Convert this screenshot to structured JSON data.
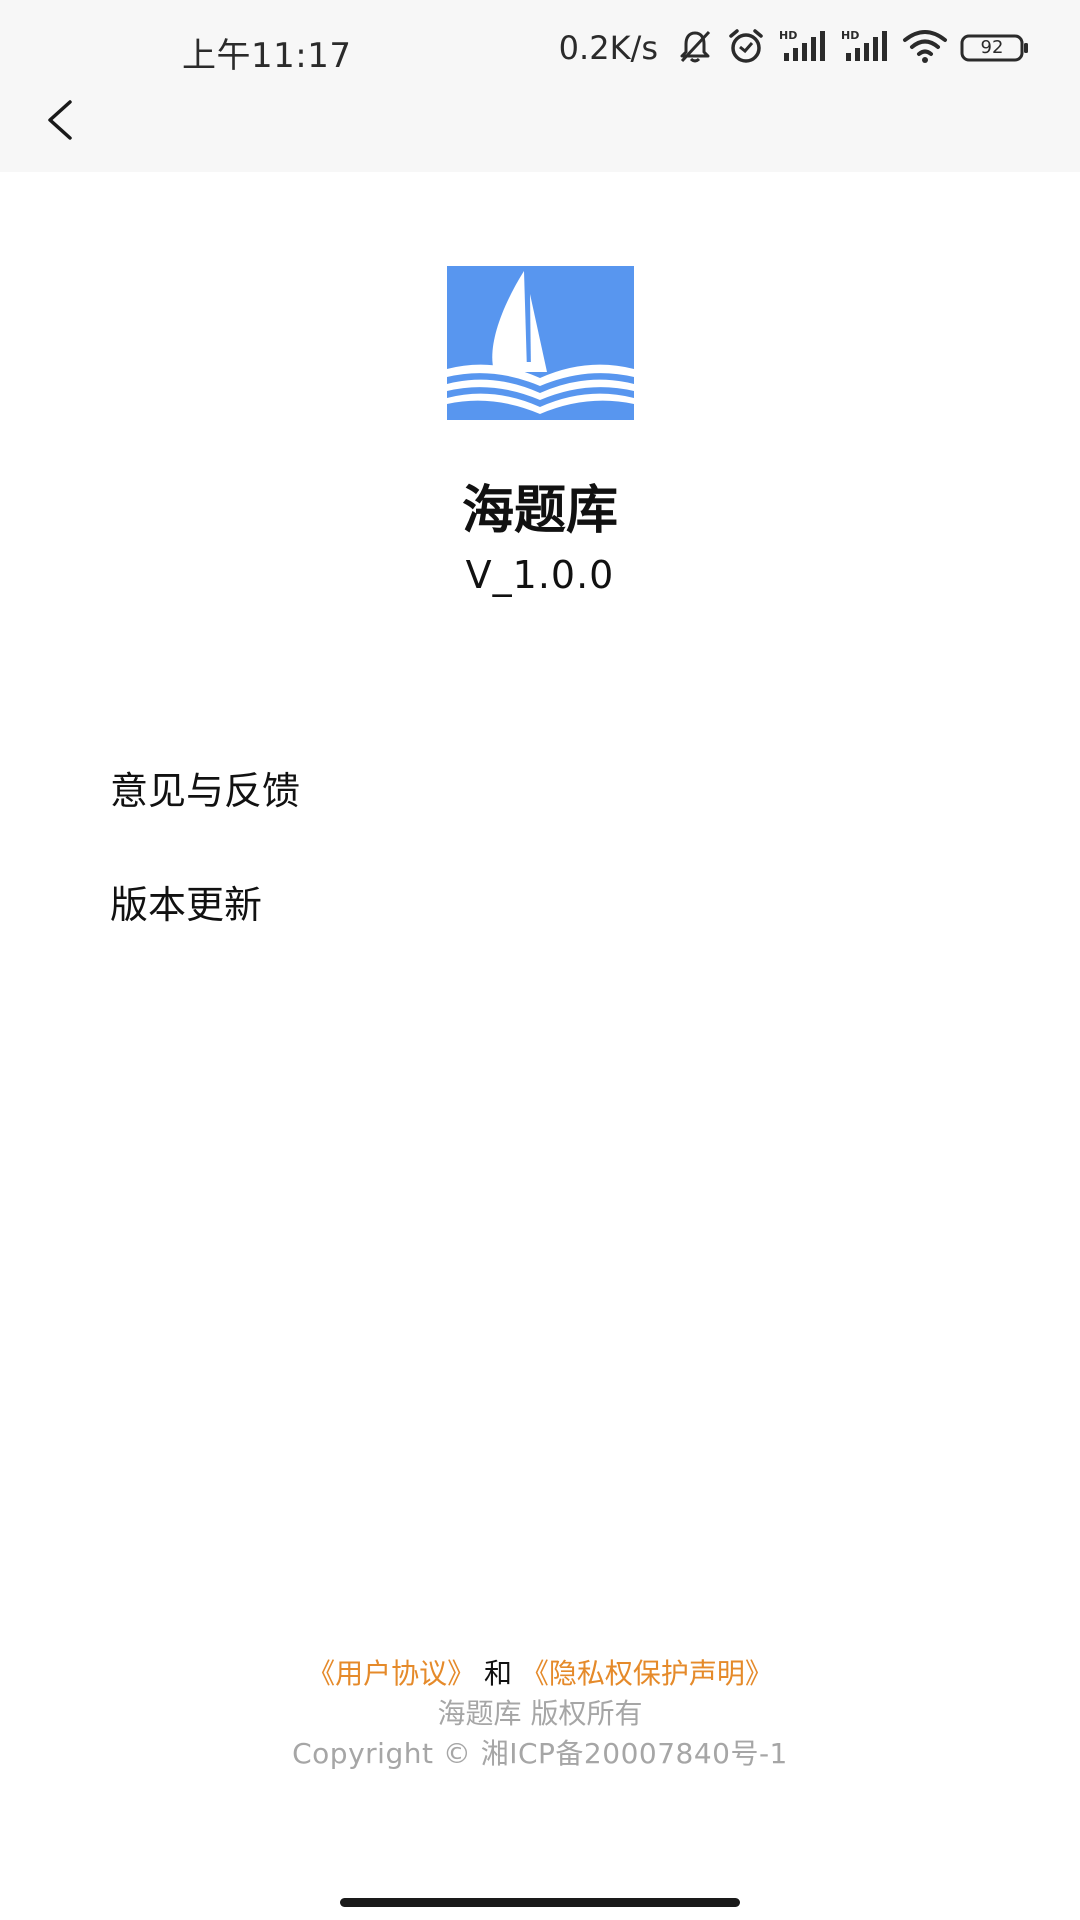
{
  "status_bar": {
    "time": "上午11:17",
    "net_speed": "0.2K/s",
    "battery_level": "92",
    "icons": [
      "mute-bell-icon",
      "alarm-icon",
      "hd-signal-icon",
      "hd-signal-icon",
      "wifi-icon",
      "battery-icon"
    ]
  },
  "nav": {
    "back_icon": "back-chevron-icon"
  },
  "app": {
    "name": "海题库",
    "version": "V_1.0.0",
    "logo_icon": "sailboat-book-icon",
    "logo_color": "#5896ef"
  },
  "menu": {
    "feedback": "意见与反馈",
    "update": "版本更新"
  },
  "footer": {
    "user_agreement": "《用户协议》",
    "and": "和",
    "privacy": "《隐私权保护声明》",
    "copyright_owner": "海题库 版权所有",
    "copyright_icp": "Copyright © 湘ICP备20007840号-1",
    "link_color": "#e58a2a"
  }
}
